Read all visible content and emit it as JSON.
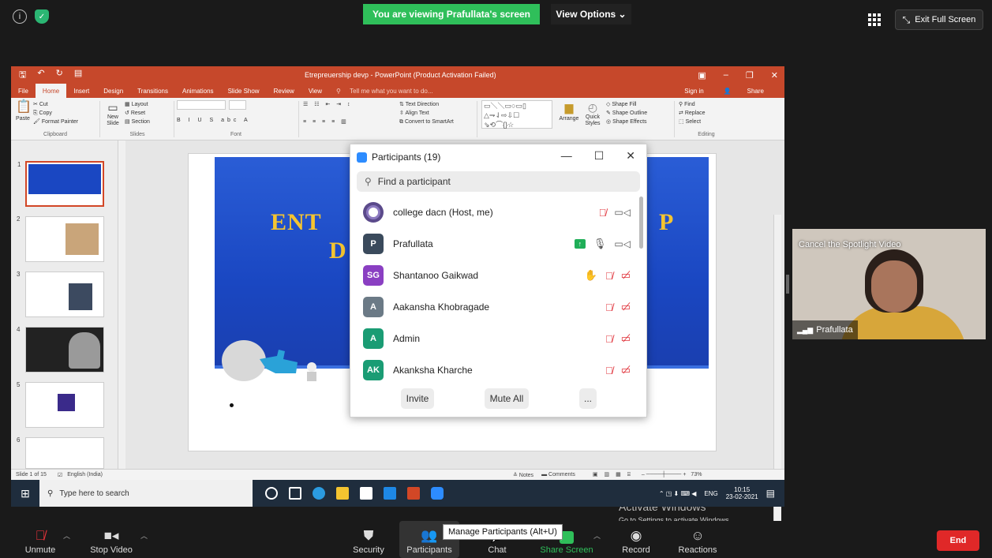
{
  "zoom": {
    "banner": "You are viewing Prafullata's screen",
    "view_options": "View Options ⌄",
    "exit_fullscreen": "Exit Full Screen",
    "spotlight_label": "Cancel the Spotlight Video",
    "spotlight_name": "Prafullata",
    "tooltip": "Manage Participants (Alt+U)",
    "toolbar": {
      "unmute": "Unmute",
      "stop_video": "Stop Video",
      "security": "Security",
      "participants": "Participants",
      "chat": "Chat",
      "share_screen": "Share Screen",
      "record": "Record",
      "reactions": "Reactions",
      "end": "End"
    },
    "accent": "#2d8cff",
    "share_green": "#2fbf5a",
    "end_red": "#e02828"
  },
  "participants_panel": {
    "title": "Participants (19)",
    "search_placeholder": "Find a participant",
    "people": [
      {
        "initials": "",
        "name": "college dacn (Host, me)",
        "color": "#5b4a8b",
        "mic": "muted",
        "cam": "on",
        "extra": ""
      },
      {
        "initials": "P",
        "name": "Prafullata",
        "color": "#3a4a5c",
        "mic": "on",
        "cam": "on",
        "extra": "sharing"
      },
      {
        "initials": "SG",
        "name": "Shantanoo Gaikwad",
        "color": "#8a3fc2",
        "mic": "muted",
        "cam": "off",
        "extra": "hand"
      },
      {
        "initials": "A",
        "name": "Aakansha Khobragade",
        "color": "#6b7a86",
        "mic": "muted",
        "cam": "off",
        "extra": ""
      },
      {
        "initials": "A",
        "name": "Admin",
        "color": "#1a9c74",
        "mic": "muted",
        "cam": "off",
        "extra": ""
      },
      {
        "initials": "AK",
        "name": "Akanksha Kharche",
        "color": "#1a9c74",
        "mic": "muted",
        "cam": "off",
        "extra": ""
      }
    ],
    "invite": "Invite",
    "mute_all": "Mute All",
    "more": "..."
  },
  "powerpoint": {
    "title": "Etrepreuership devp - PowerPoint (Product Activation Failed)",
    "tabs": [
      "File",
      "Home",
      "Insert",
      "Design",
      "Transitions",
      "Animations",
      "Slide Show",
      "Review",
      "View"
    ],
    "tell_me": "Tell me what you want to do...",
    "sign_in": "Sign in",
    "share": "Share",
    "clipboard": {
      "cut": "Cut",
      "copy": "Copy",
      "format_painter": "Format Painter",
      "paste": "Paste",
      "label": "Clipboard"
    },
    "slides_group": {
      "new_slide": "New Slide",
      "layout": "Layout",
      "reset": "Reset",
      "section": "Section",
      "label": "Slides"
    },
    "font_label": "Font",
    "paragraph": {
      "text_direction": "Text Direction",
      "align_text": "Align Text",
      "smartart": "Convert to SmartArt"
    },
    "drawing": {
      "arrange": "Arrange",
      "quick_styles": "Quick Styles",
      "shape_fill": "Shape Fill",
      "shape_outline": "Shape Outline",
      "shape_effects": "Shape Effects"
    },
    "editing": {
      "find": "Find",
      "replace": "Replace",
      "select": "Select",
      "label": "Editing"
    },
    "slide_heading_left": "ENT",
    "slide_heading_left2": "D",
    "slide_heading_right": "P",
    "status": {
      "slide": "Slide 1 of 15",
      "language": "English (India)",
      "notes": "Notes",
      "comments": "Comments",
      "zoom": "73%"
    },
    "activate_title": "Activate Windows",
    "activate_sub": "Go to Settings to activate Windows.",
    "taskbar": {
      "search": "Type here to search",
      "lang": "ENG",
      "time": "10:15",
      "date": "23-02-2021"
    }
  }
}
